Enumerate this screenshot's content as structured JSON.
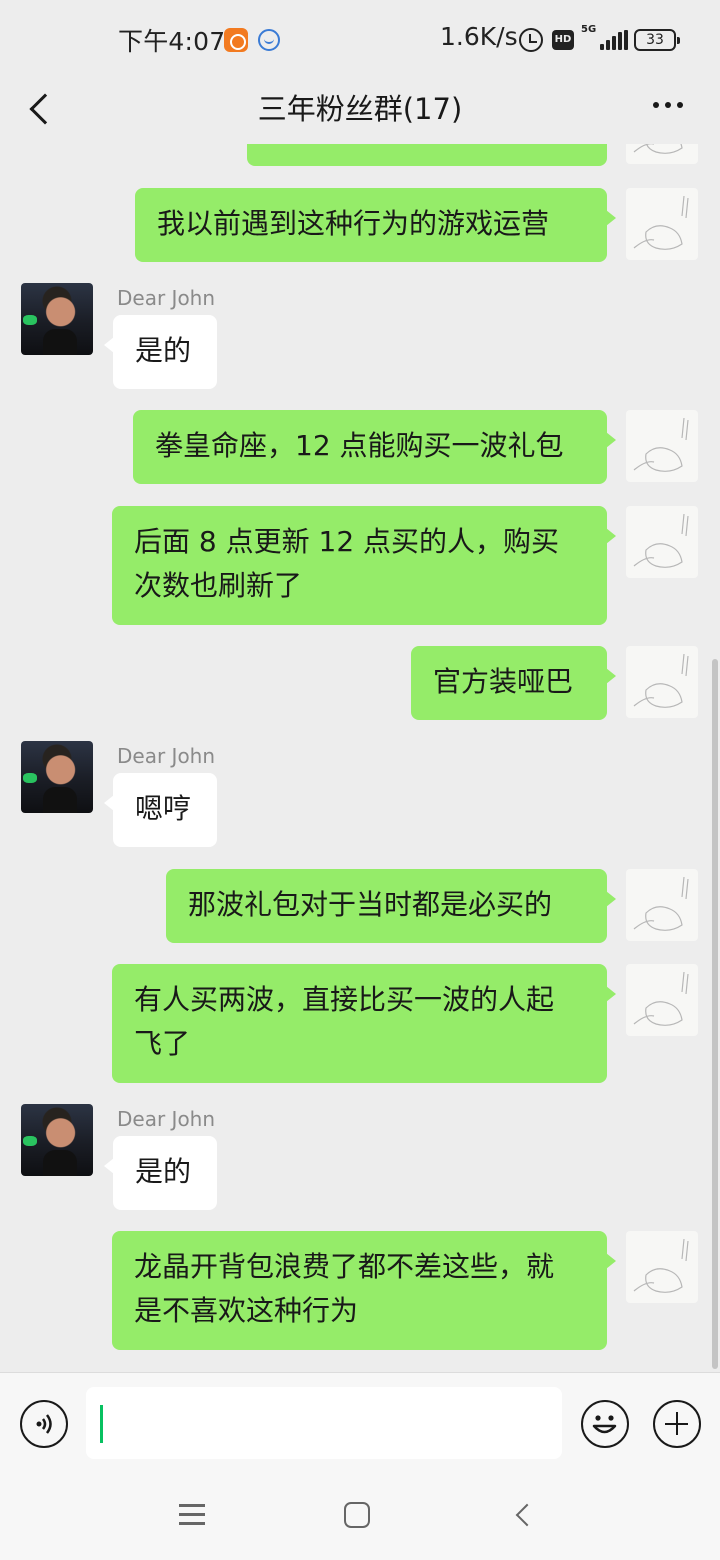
{
  "status_bar": {
    "time": "下午4:07",
    "net_speed": "1.6K/s",
    "network_type": "5G",
    "hd_label": "HD",
    "battery": "33",
    "icons": [
      "uc-browser-icon",
      "chat-app-icon",
      "alarm-icon",
      "hd-icon",
      "signal-icon",
      "battery-icon"
    ]
  },
  "header": {
    "title": "三年粉丝群(17)",
    "back_icon": "chevron-left-icon",
    "more_icon": "more-dots-icon"
  },
  "messages": [
    {
      "side": "out",
      "text": ""
    },
    {
      "side": "out",
      "text": "我以前遇到这种行为的游戏运营"
    },
    {
      "side": "in",
      "sender": "Dear John",
      "text": "是的"
    },
    {
      "side": "out",
      "text": "拳皇命座，12 点能购买一波礼包"
    },
    {
      "side": "out",
      "lines": [
        "后面 8 点更新 12 点买的人，购买",
        "次数也刷新了"
      ]
    },
    {
      "side": "out",
      "text": "官方装哑巴"
    },
    {
      "side": "in",
      "sender": "Dear John",
      "text": "嗯哼"
    },
    {
      "side": "out",
      "text": "那波礼包对于当时都是必买的"
    },
    {
      "side": "out",
      "lines": [
        "有人买两波，直接比买一波的人起",
        "飞了"
      ]
    },
    {
      "side": "in",
      "sender": "Dear John",
      "text": "是的"
    },
    {
      "side": "out",
      "lines": [
        "龙晶开背包浪费了都不差这些，就",
        "是不喜欢这种行为"
      ]
    }
  ],
  "input_bar": {
    "placeholder": "",
    "value": "",
    "voice_icon": "voice-icon",
    "emoji_icon": "emoji-icon",
    "plus_icon": "plus-icon"
  },
  "colors": {
    "outgoing_bubble": "#95ec69",
    "incoming_bubble": "#ffffff",
    "background": "#ededed",
    "caret": "#07c160"
  },
  "system_nav": [
    "menu-icon",
    "home-icon",
    "back-icon"
  ]
}
